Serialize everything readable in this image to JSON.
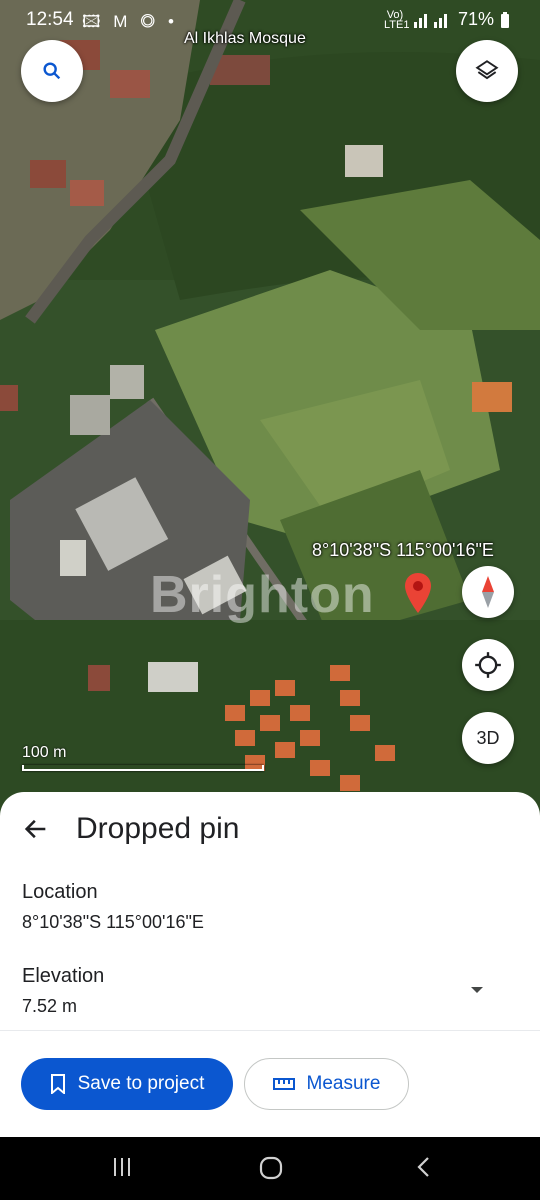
{
  "status_bar": {
    "time": "12:54",
    "left_icons": "🖾 M ◎ •",
    "network": "Vo) LTE1",
    "battery": "71%"
  },
  "map": {
    "poi_label": "Al Ikhlas Mosque",
    "coordinate_label": "8°10'38\"S 115°00'16\"E",
    "watermark": "Brighton",
    "scale_label": "100 m",
    "view_3d_label": "3D"
  },
  "sheet": {
    "title": "Dropped pin",
    "location_label": "Location",
    "location_value": "8°10'38\"S 115°00'16\"E",
    "elevation_label": "Elevation",
    "elevation_value": "7.52 m",
    "save_button": "Save to project",
    "measure_button": "Measure"
  },
  "colors": {
    "primary": "#0b57d0",
    "pin": "#ea4335"
  }
}
